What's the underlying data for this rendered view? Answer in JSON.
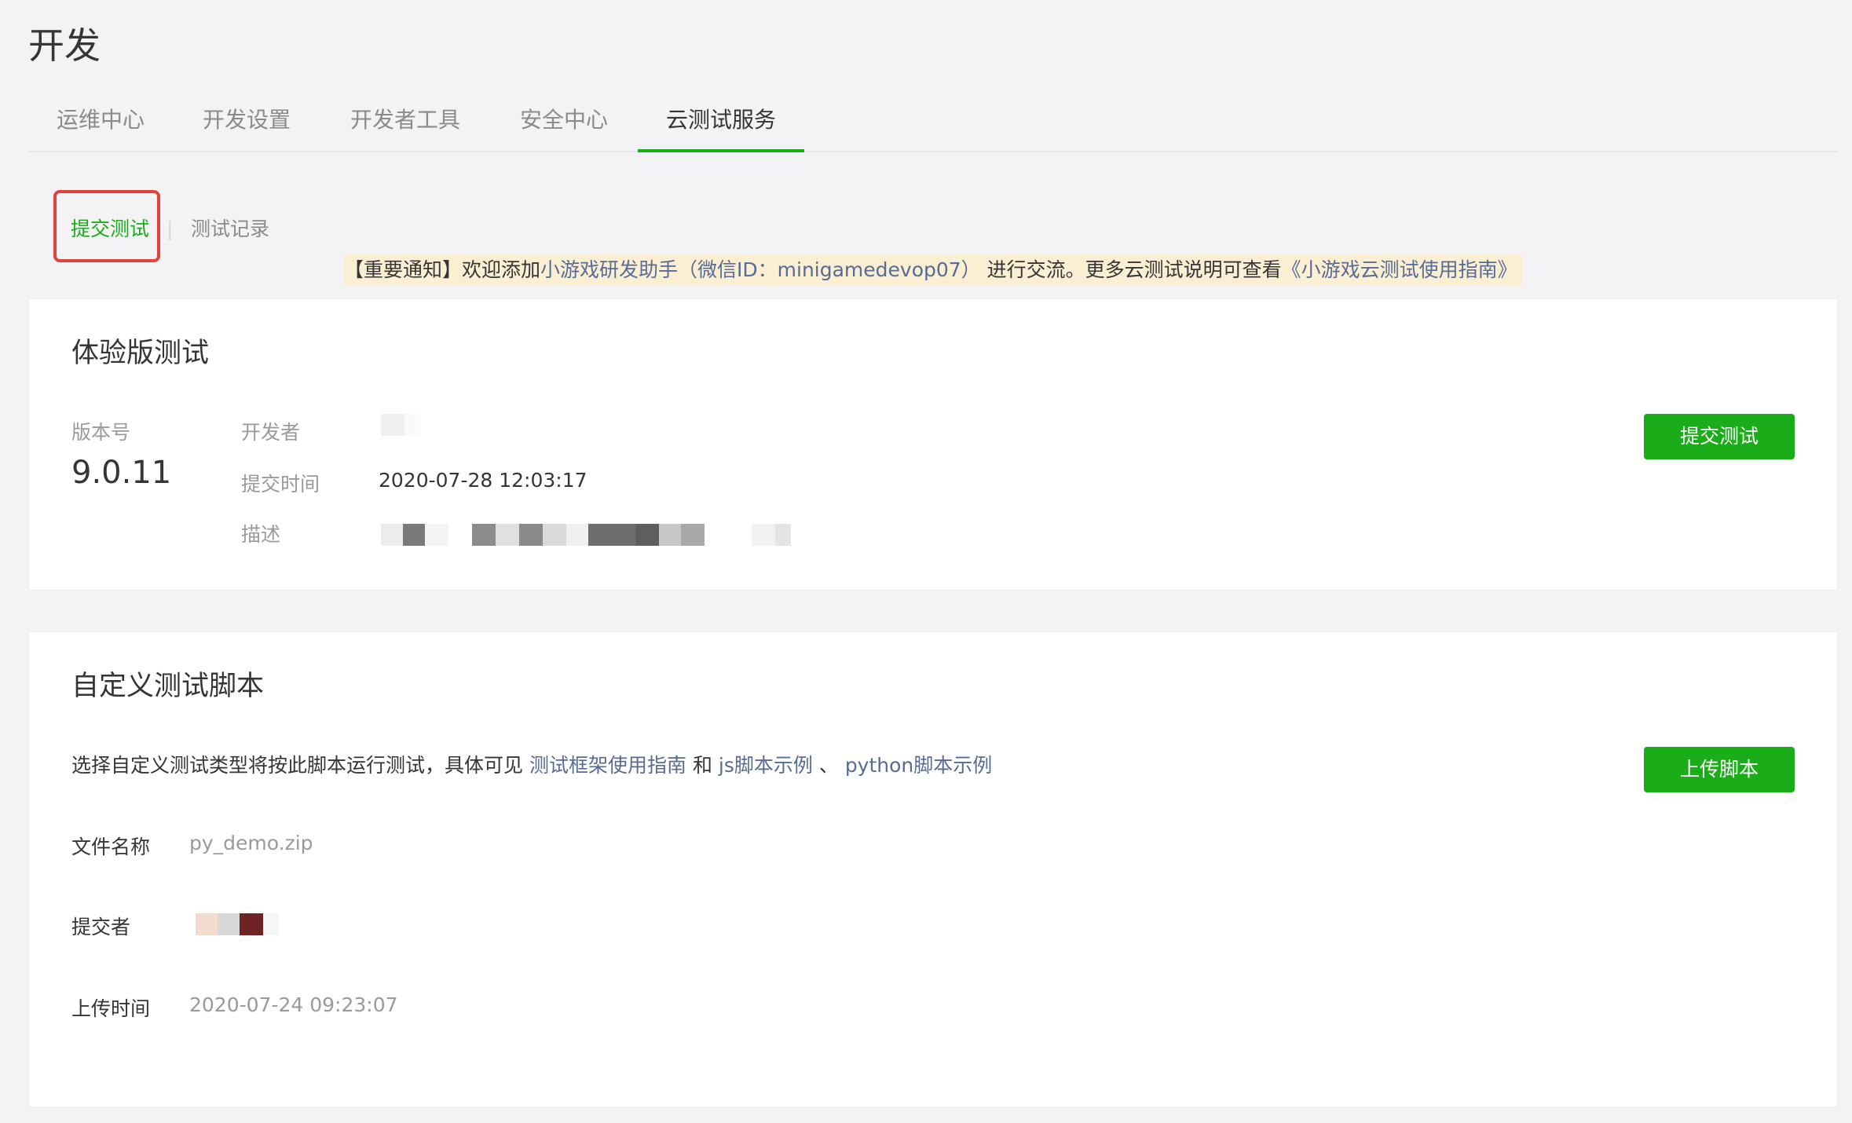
{
  "page": {
    "title": "开发"
  },
  "tabs": [
    {
      "label": "运维中心"
    },
    {
      "label": "开发设置"
    },
    {
      "label": "开发者工具"
    },
    {
      "label": "安全中心"
    },
    {
      "label": "云测试服务"
    }
  ],
  "active_tab": "云测试服务",
  "subnav": {
    "active_label": "提交测试",
    "separator": "|",
    "other_label": "测试记录"
  },
  "notice": {
    "prefix": "【重要通知】欢迎添加",
    "link1": "小游戏研发助手（微信ID：minigamedevop07）",
    "middle": "进行交流。更多云测试说明可查看",
    "link2": "《小游戏云测试使用指南》"
  },
  "trial": {
    "title": "体验版测试",
    "version_label": "版本号",
    "version_value": "9.0.11",
    "developer_label": "开发者",
    "submit_time_label": "提交时间",
    "submit_time_value": "2020-07-28 12:03:17",
    "desc_label": "描述",
    "submit_button": "提交测试"
  },
  "script": {
    "title": "自定义测试脚本",
    "desc_prefix": "选择自定义测试类型将按此脚本运行测试，具体可见",
    "link_framework": "测试框架使用指南",
    "and_text": "和",
    "link_js": "js脚本示例",
    "sep_text": "、",
    "link_python": "python脚本示例",
    "upload_button": "上传脚本",
    "file_name_label": "文件名称",
    "file_name_value": "py_demo.zip",
    "submitter_label": "提交者",
    "upload_time_label": "上传时间",
    "upload_time_value": "2020-07-24 09:23:07"
  },
  "colors": {
    "accent_green": "#1aad19",
    "link_blue": "#576b95",
    "notice_bg": "#fbefd3",
    "highlight_red": "#e0433a"
  }
}
